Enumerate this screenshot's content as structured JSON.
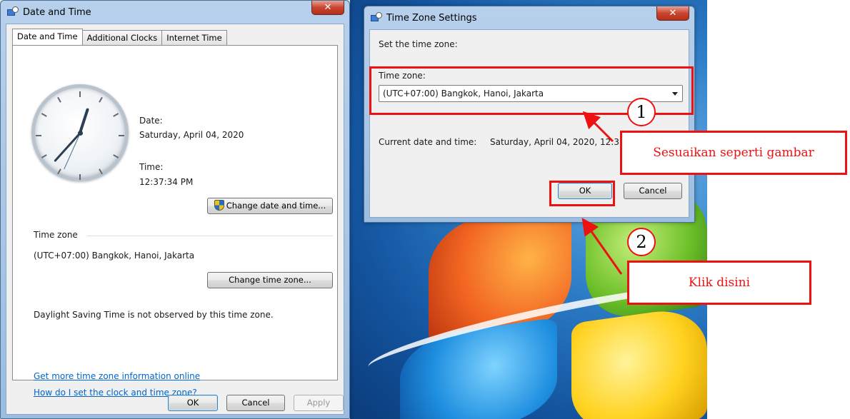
{
  "date_time_window": {
    "title": "Date and Time",
    "tabs": [
      "Date and Time",
      "Additional Clocks",
      "Internet Time"
    ],
    "date_label": "Date:",
    "date_value": "Saturday, April 04, 2020",
    "time_label": "Time:",
    "time_value": "12:37:34 PM",
    "change_date_time_button": "Change date and time...",
    "time_zone_group": "Time zone",
    "time_zone_value": "(UTC+07:00) Bangkok, Hanoi, Jakarta",
    "change_time_zone_button": "Change time zone...",
    "dst_note": "Daylight Saving Time is not observed by this time zone.",
    "link_more_info": "Get more time zone information online",
    "link_how_set": "How do I set the clock and time zone?",
    "ok_button": "OK",
    "cancel_button": "Cancel",
    "apply_button": "Apply"
  },
  "time_zone_window": {
    "title": "Time Zone Settings",
    "instruction": "Set the time zone:",
    "time_zone_label": "Time zone:",
    "time_zone_selected": "(UTC+07:00) Bangkok, Hanoi, Jakarta",
    "current_label": "Current date and time:",
    "current_value": "Saturday, April 04, 2020, 12:37 PM",
    "ok_button": "OK",
    "cancel_button": "Cancel"
  },
  "annotations": {
    "step1_number": "1",
    "step1_text": "Sesuaikan seperti gambar",
    "step2_number": "2",
    "step2_text": "Klik disini",
    "color": "#ee1111"
  },
  "icons": {
    "window_icon": "date-time-icon",
    "close": "close-icon",
    "shield": "uac-shield-icon",
    "dropdown": "chevron-down-icon"
  }
}
